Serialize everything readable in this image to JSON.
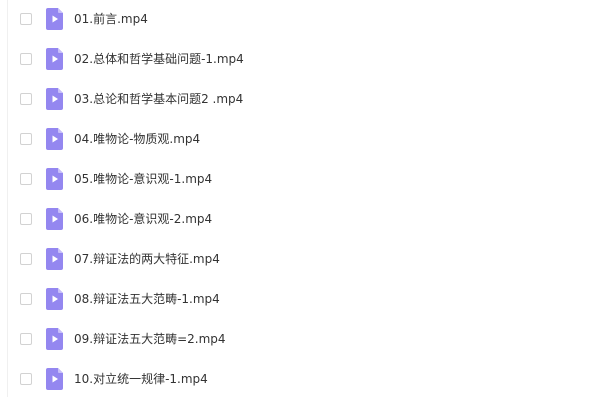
{
  "icon_color": "#9487f0",
  "icon_fold_color": "#c7bffa",
  "files": [
    {
      "name": "01.前言.mp4",
      "icon": "video-file-icon"
    },
    {
      "name": "02.总体和哲学基础问题-1.mp4",
      "icon": "video-file-icon"
    },
    {
      "name": "03.总论和哲学基本问题2 .mp4",
      "icon": "video-file-icon"
    },
    {
      "name": "04.唯物论-物质观.mp4",
      "icon": "video-file-icon"
    },
    {
      "name": "05.唯物论-意识观-1.mp4",
      "icon": "video-file-icon"
    },
    {
      "name": "06.唯物论-意识观-2.mp4",
      "icon": "video-file-icon"
    },
    {
      "name": "07.辩证法的两大特征.mp4",
      "icon": "video-file-icon"
    },
    {
      "name": "08.辩证法五大范畴-1.mp4",
      "icon": "video-file-icon"
    },
    {
      "name": "09.辩证法五大范畴=2.mp4",
      "icon": "video-file-icon"
    },
    {
      "name": "10.对立统一规律-1.mp4",
      "icon": "video-file-icon"
    }
  ]
}
